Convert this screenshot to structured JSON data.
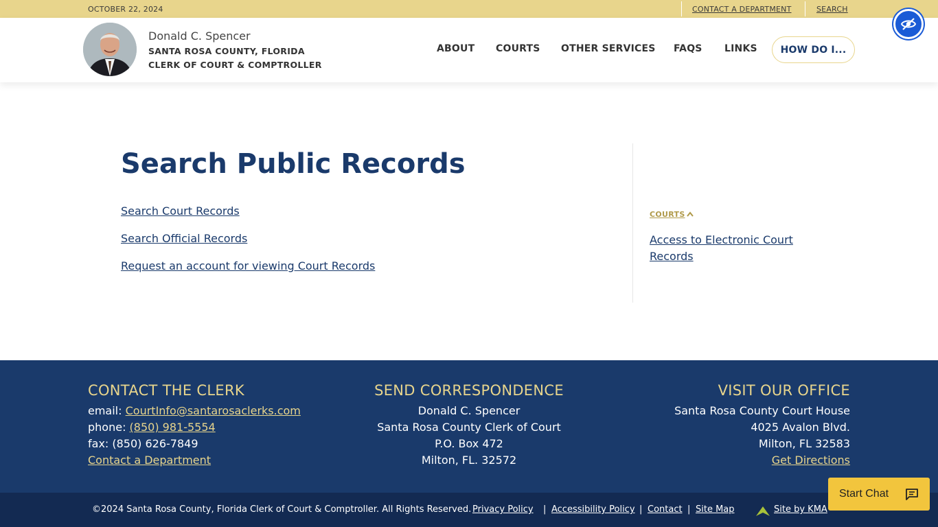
{
  "topbar": {
    "date": "OCTOBER 22, 2024",
    "contact_label": "CONTACT A DEPARTMENT",
    "search_label": "SEARCH"
  },
  "header": {
    "name": "Donald C. Spencer",
    "line1": "SANTA ROSA COUNTY, FLORIDA",
    "line2": "CLERK OF COURT & COMPTROLLER",
    "nav": [
      "ABOUT",
      "COURTS",
      "OTHER SERVICES",
      "FAQS",
      "LINKS"
    ],
    "how_do_i": "HOW DO I..."
  },
  "main": {
    "title": "Search Public Records",
    "links": [
      "Search Court Records",
      "Search Official Records",
      "Request an account for viewing Court Records"
    ]
  },
  "sidebar": {
    "category": "COURTS",
    "link": "Access to Electronic Court Records"
  },
  "footer": {
    "contact": {
      "heading": "CONTACT THE CLERK",
      "email_label": "email: ",
      "email": "CourtInfo@santarosaclerks.com",
      "phone_label": "phone: ",
      "phone": "(850) 981-5554",
      "fax": "fax: (850) 626-7849",
      "contact_link": "Contact a Department"
    },
    "correspondence": {
      "heading": "SEND CORRESPONDENCE",
      "lines": [
        "Donald C. Spencer",
        "Santa Rosa County Clerk of Court",
        "P.O. Box 472",
        "Milton, FL. 32572"
      ]
    },
    "office": {
      "heading": "VISIT OUR OFFICE",
      "lines": [
        "Santa Rosa County Court House",
        "4025 Avalon Blvd.",
        "Milton, FL 32583"
      ],
      "directions": "Get Directions"
    }
  },
  "bottombar": {
    "copyright": "©2024 Santa Rosa County, Florida Clerk of Court & Comptroller. All Rights Reserved.",
    "links": [
      "Privacy Policy",
      "Accessibility Policy",
      "Contact",
      "Site Map"
    ],
    "kma": "Site by KMA"
  },
  "chat": {
    "label": "Start Chat"
  },
  "colors": {
    "gold": "#e8d58c",
    "navy": "#1a3a6b",
    "chat_yellow": "#f2c53d",
    "accessibility_blue": "#1a5bd6"
  },
  "icons": [
    "accessibility-eye-icon",
    "chevron-up-icon",
    "chat-bubble-icon",
    "kma-logo-icon"
  ]
}
